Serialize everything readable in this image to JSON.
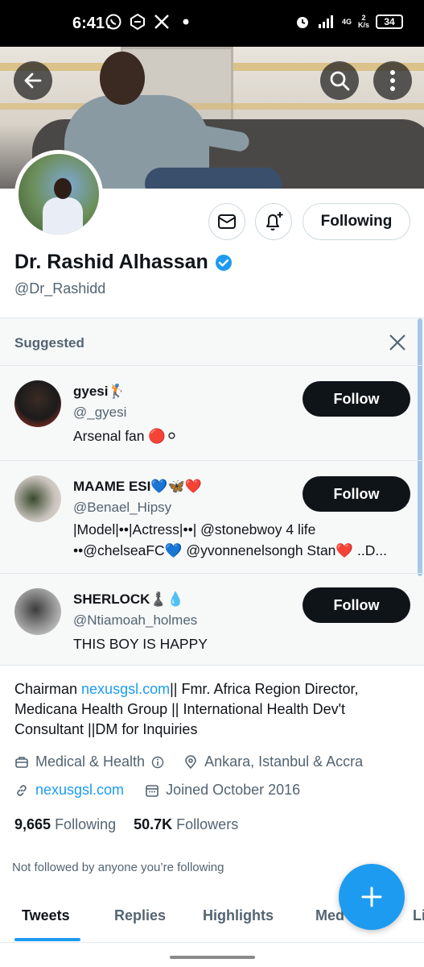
{
  "status_bar": {
    "time": "6:41",
    "network": "4G",
    "net_speed_top": "2",
    "net_speed_bottom": "K/s",
    "battery": "34"
  },
  "profile": {
    "display_name": "Dr. Rashid Alhassan",
    "handle": "@Dr_Rashidd",
    "following_button": "Following"
  },
  "suggested": {
    "title": "Suggested",
    "items": [
      {
        "name": "gyesi🏌️",
        "handle": "@_gyesi",
        "bio": "Arsenal fan 🔴⚪",
        "button": "Follow"
      },
      {
        "name": "MAAME ESI💙🦋❤️",
        "handle": "@Benael_Hipsy",
        "bio_line1": "|Model|••|Actress|••| @stonebwoy 4 life",
        "bio_line2": "••@chelseaFC💙 @yvonnenelsongh Stan❤️ ..D...",
        "button": "Follow"
      },
      {
        "name": "SHERLOCK♟️💧",
        "handle": "@Ntiamoah_holmes",
        "bio": "THIS BOY IS HAPPY",
        "button": "Follow"
      }
    ]
  },
  "bio": {
    "prefix": "Chairman ",
    "link": "nexusgsl.com",
    "rest": "|| Fmr. Africa Region Director, Medicana Health Group || International Health Dev't Consultant ||DM for Inquiries"
  },
  "meta": {
    "category": "Medical & Health",
    "location": "Ankara, Istanbul & Accra",
    "website": "nexusgsl.com",
    "joined": "Joined October 2016"
  },
  "stats": {
    "following_count": "9,665",
    "following_label": "Following",
    "followers_count": "50.7K",
    "followers_label": "Followers"
  },
  "not_followed_text": "Not followed by anyone you’re following",
  "tabs": [
    "Tweets",
    "Replies",
    "Highlights",
    "Media",
    "Likes"
  ],
  "tab_partial": [
    "Med",
    "Li"
  ],
  "colors": {
    "accent": "#1d9bf0",
    "text": "#0f1419",
    "muted": "#536471"
  }
}
